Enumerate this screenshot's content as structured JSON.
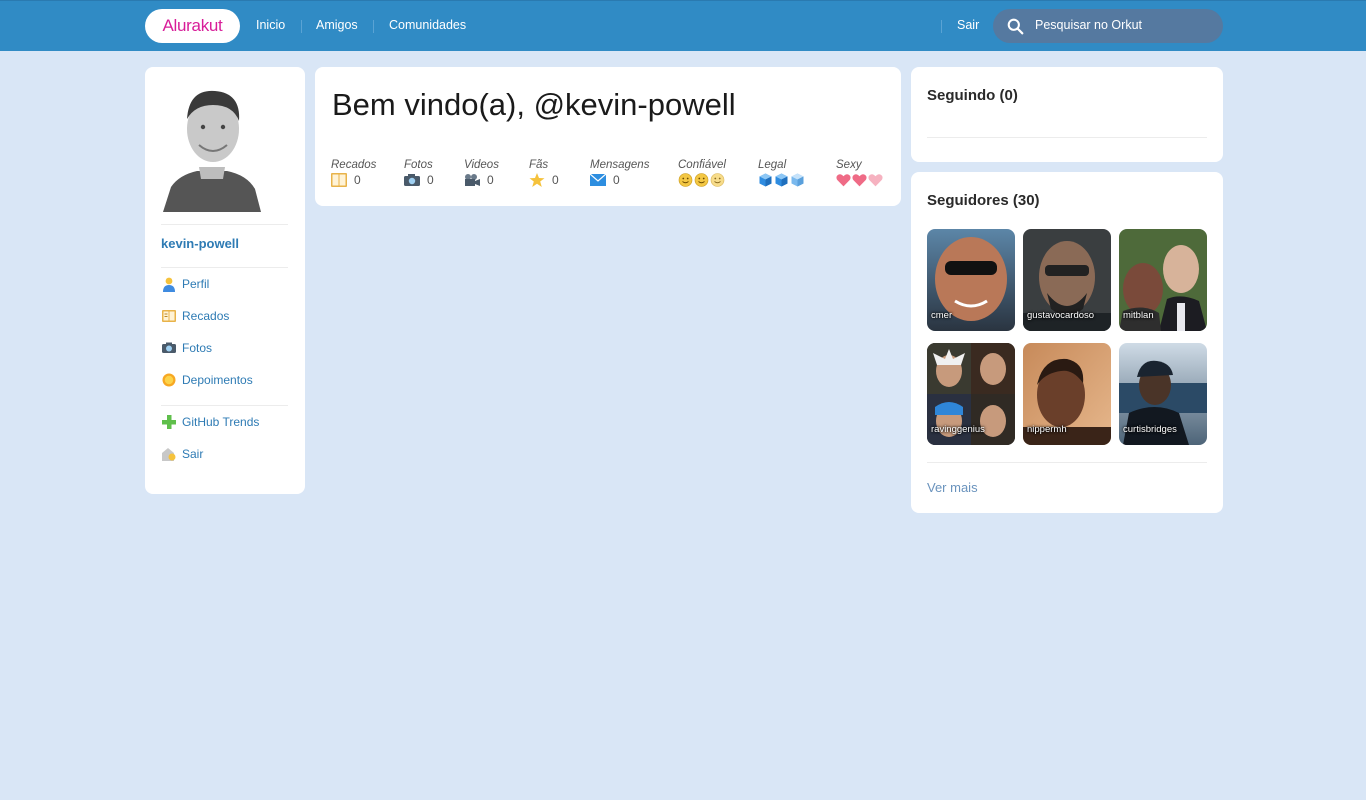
{
  "header": {
    "logo_text": "Alurakut",
    "nav": [
      {
        "label": "Inicio"
      },
      {
        "label": "Amigos"
      },
      {
        "label": "Comunidades"
      }
    ],
    "logout_label": "Sair",
    "search": {
      "placeholder": "Pesquisar no Orkut",
      "icon": "search-icon"
    }
  },
  "sidebar": {
    "username": "kevin-powell",
    "menu": [
      {
        "label": "Perfil",
        "icon": "user-icon"
      },
      {
        "label": "Recados",
        "icon": "book-icon"
      },
      {
        "label": "Fotos",
        "icon": "camera-icon"
      },
      {
        "label": "Depoimentos",
        "icon": "sun-icon"
      },
      {
        "label": "GitHub Trends",
        "icon": "plus-icon"
      },
      {
        "label": "Sair",
        "icon": "logout-icon"
      }
    ]
  },
  "main": {
    "welcome": "Bem vindo(a), @kevin-powell",
    "stats": [
      {
        "label": "Recados",
        "value": "0",
        "icon": "book-icon"
      },
      {
        "label": "Fotos",
        "value": "0",
        "icon": "camera-icon"
      },
      {
        "label": "Videos",
        "value": "0",
        "icon": "video-camera-icon"
      },
      {
        "label": "Fãs",
        "value": "0",
        "icon": "star-icon"
      },
      {
        "label": "Mensagens",
        "value": "0",
        "icon": "envelope-icon"
      },
      {
        "label": "Confiável",
        "icon": "smiley-icon",
        "level": 3
      },
      {
        "label": "Legal",
        "icon": "ice-cube-icon",
        "level": 3
      },
      {
        "label": "Sexy",
        "icon": "heart-icon",
        "level": 3
      }
    ]
  },
  "following": {
    "title": "Seguindo (0)"
  },
  "followers": {
    "title": "Seguidores (30)",
    "items": [
      {
        "name": "cmer"
      },
      {
        "name": "gustavocardoso"
      },
      {
        "name": "mitblan"
      },
      {
        "name": "ravinggenius"
      },
      {
        "name": "nippermh"
      },
      {
        "name": "curtisbridges"
      }
    ],
    "see_more": "Ver mais"
  },
  "colors": {
    "topbar": "#308bc5",
    "background": "#d9e6f6",
    "link": "#2e7bb4",
    "logo_pink": "#d81d99"
  }
}
